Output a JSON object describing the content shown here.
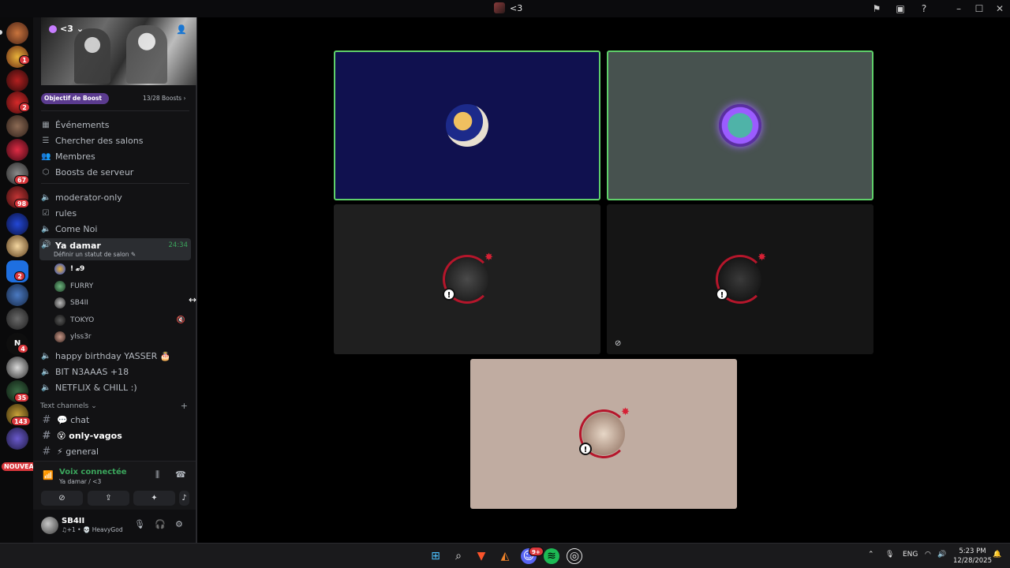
{
  "window": {
    "title": "<3"
  },
  "server": {
    "name": "<3",
    "boost_goal_label": "Objectif de Boost",
    "boost_count": "13/28 Boosts ›"
  },
  "menu": [
    {
      "label": "Événements",
      "icon": "calendar-icon"
    },
    {
      "label": "Chercher des salons",
      "icon": "channel-list-icon"
    },
    {
      "label": "Membres",
      "icon": "members-icon"
    },
    {
      "label": "Boosts de serveur",
      "icon": "boost-shield-icon"
    }
  ],
  "channels": {
    "moderator": "moderator-only",
    "rules": "rules",
    "come_noi": "Come Noi",
    "active_voice": {
      "name": "Ya damar",
      "status_hint": "Définir un statut de salon ✎",
      "time": "24:34"
    },
    "voice_users": [
      "! 𝔁9",
      "FURRY",
      "SB4II",
      "TOKYO",
      "ylss3r"
    ],
    "happy": "happy birthday YASSER 🎂",
    "bit": "BIT N3AAAS +18",
    "netflix": "NETFLIX & CHILL :)",
    "text_category": "Text channels ⌄",
    "text_channels": [
      "💬 chat",
      "😵 only-vagos",
      "⚡ general"
    ]
  },
  "servers_rail": {
    "badges": [
      "1",
      "2",
      "67",
      "98",
      "2",
      "4",
      "35",
      "143"
    ],
    "new_label": "NOUVEAU"
  },
  "voice_panel": {
    "title": "Voix connectée",
    "subtitle": "Ya damar / <3"
  },
  "user": {
    "name": "SB4II",
    "status": "♫+1 • 💀 HeavyGod"
  },
  "tiles": [
    {
      "color": "#10114f",
      "speaking": true,
      "avatar": "blue-gold-avatar"
    },
    {
      "color": "#47524f",
      "speaking": true,
      "avatar": "purple-frame-avatar"
    },
    {
      "color": "#1f1f1f",
      "speaking": false,
      "avatar": "dark-hair-avatar",
      "idle": true
    },
    {
      "color": "#151515",
      "speaking": false,
      "avatar": "dark-figure-avatar",
      "idle": true,
      "camera_off": true
    },
    {
      "color": "#c0aca1",
      "speaking": false,
      "avatar": "street-photo-avatar",
      "idle": true
    }
  ],
  "taskbar": {
    "lang": "ENG",
    "time": "5:23 PM",
    "date": "12/28/2025",
    "discord_badge": "9+"
  },
  "colors": {
    "accent_green": "#3ba55c",
    "speaking_border": "#5fd06a",
    "badge_red": "#da373c"
  }
}
